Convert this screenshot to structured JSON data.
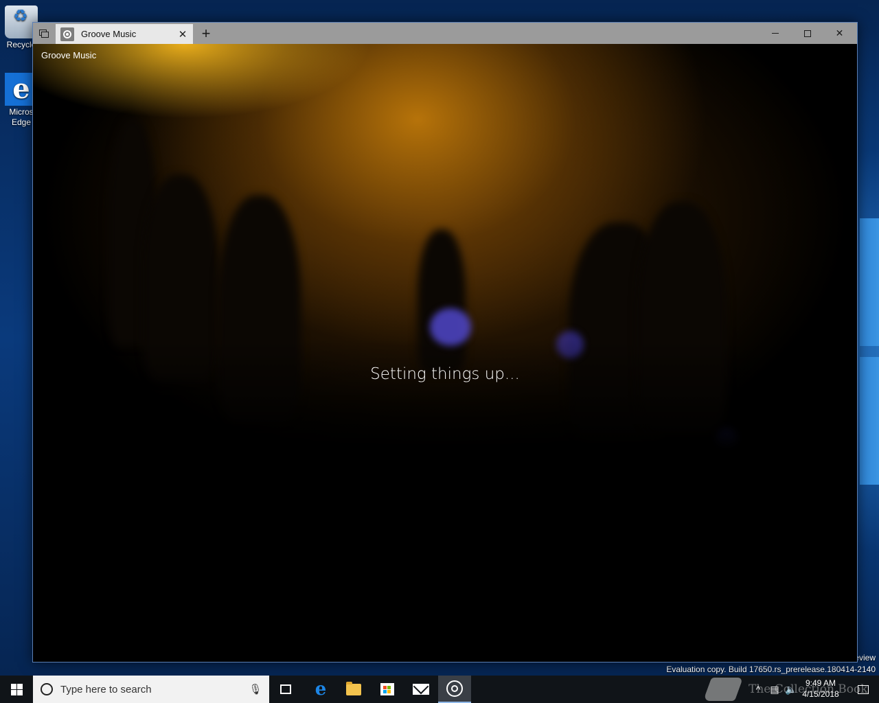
{
  "desktop": {
    "icons": [
      {
        "label": "Recycle",
        "icon": "recycle-bin-icon"
      },
      {
        "label": "Micros Edge",
        "line1": "Micros",
        "line2": "Edge",
        "icon": "edge-icon"
      }
    ],
    "preview_text": "eview",
    "evaluation_text": "Evaluation copy. Build 17650.rs_prerelease.180414-2140"
  },
  "window": {
    "tab_title": "Groove Music",
    "app_title": "Groove Music",
    "status_message": "Setting things up...",
    "buttons": {
      "tabs_overview": "tabs-overview-icon",
      "new_tab": "+",
      "tab_close": "✕",
      "minimize": "minimize-icon",
      "maximize": "maximize-icon",
      "close": "✕"
    }
  },
  "taskbar": {
    "search_placeholder": "Type here to search",
    "apps": [
      {
        "name": "task-view",
        "icon": "task-view-icon"
      },
      {
        "name": "edge",
        "icon": "edge-icon",
        "glyph": "e"
      },
      {
        "name": "file-explorer",
        "icon": "folder-icon"
      },
      {
        "name": "store",
        "icon": "store-icon"
      },
      {
        "name": "mail",
        "icon": "mail-icon"
      },
      {
        "name": "groove-music",
        "icon": "groove-icon",
        "active": true
      }
    ],
    "clock_time": "9:49 AM",
    "clock_date": "4/15/2018",
    "tray_icons": [
      "chevron-up-icon",
      "network-icon",
      "volume-icon"
    ]
  },
  "watermark": {
    "text": "The Collection Book"
  },
  "colors": {
    "titlebar": "#9b9b9b",
    "taskbar": "#101418",
    "desktop": "#0a3a7c",
    "accent": "#1d86e6"
  }
}
